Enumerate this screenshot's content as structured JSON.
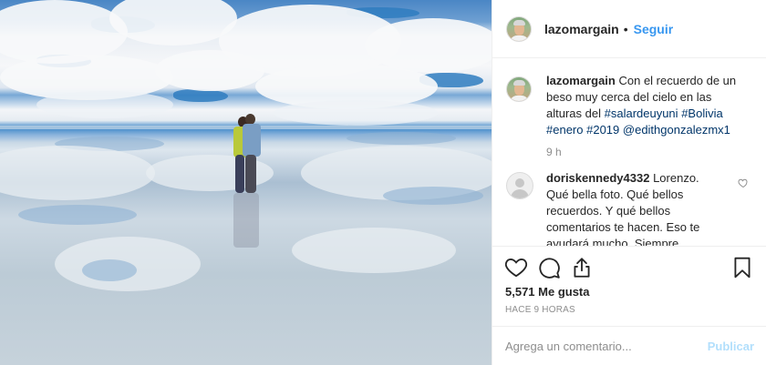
{
  "post": {
    "username": "lazomargain",
    "separator": "•",
    "follow_label": "Seguir",
    "caption": {
      "username": "lazomargain",
      "text_before": "Con el recuerdo de un beso muy cerca del cielo en las alturas del",
      "tags": [
        "#salardeuyuni",
        "#Bolivia",
        "#enero",
        "#2019",
        "@edithgonzalezmx1"
      ],
      "time": "9 h"
    },
    "comments": [
      {
        "username": "doriskennedy4332",
        "text": "Lorenzo. Qué bella foto. Qué bellos recuerdos. Y qué bellos comentarios te hacen. Eso te ayudará mucho. Siempre"
      }
    ],
    "likes_label": "5,571 Me gusta",
    "date_label": "HACE 9 HORAS",
    "comment_placeholder": "Agrega un comentario...",
    "post_button_label": "Publicar"
  },
  "icons": {
    "like": "heart-icon",
    "comment": "comment-icon",
    "share": "share-icon",
    "save": "bookmark-icon",
    "comment_like": "small-heart-icon"
  },
  "colors": {
    "link_blue": "#3897f0",
    "hashtag": "#003569",
    "muted": "#8e8e8e",
    "post_disabled": "#b2dffc"
  }
}
